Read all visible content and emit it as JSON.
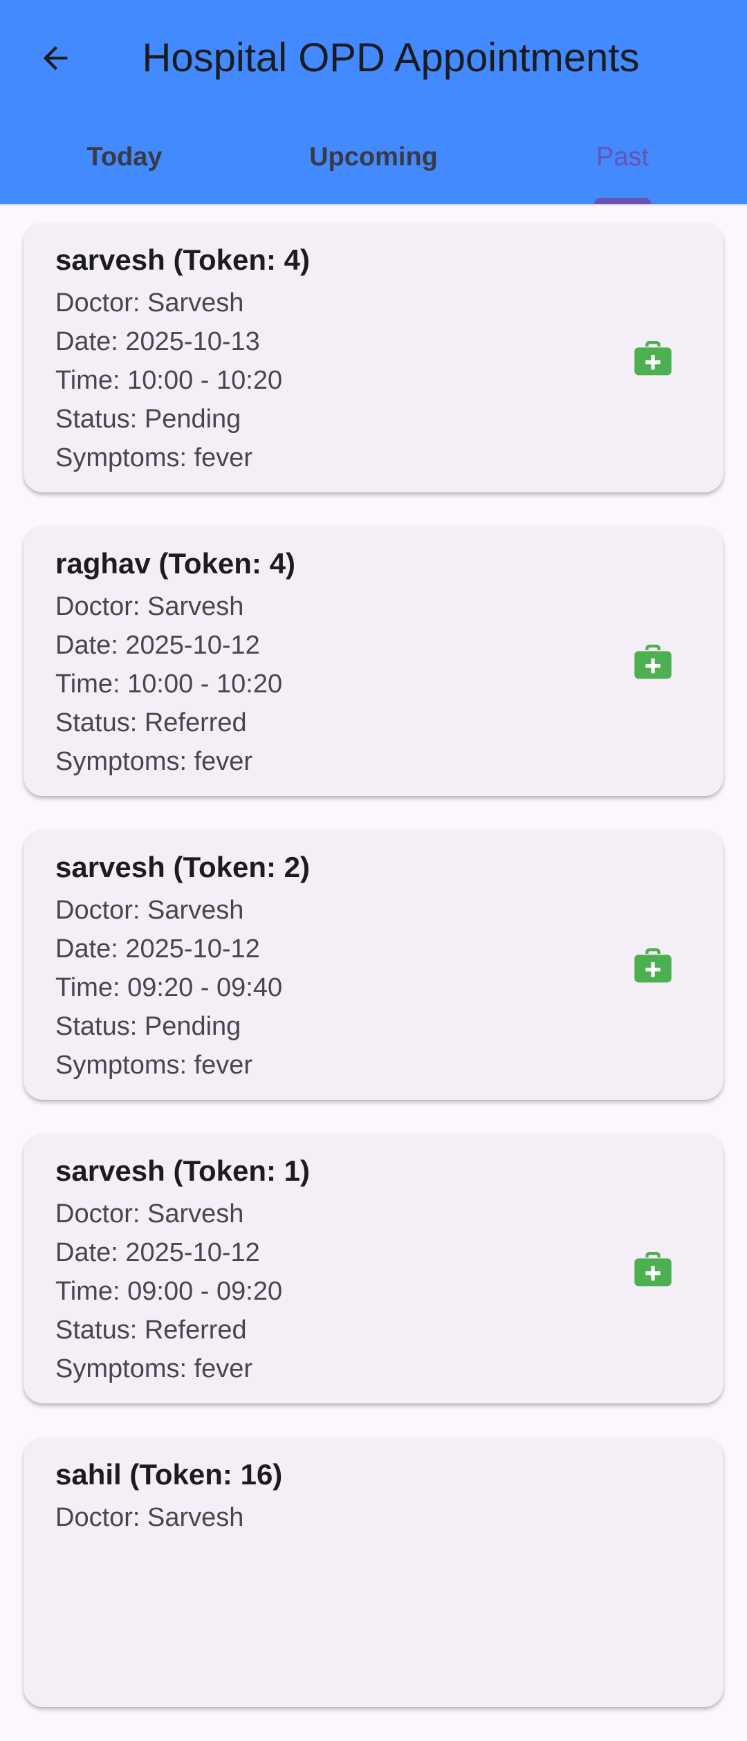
{
  "header": {
    "title": "Hospital OPD Appointments",
    "back_icon": "arrow-back-icon",
    "background_color": "#448AFF"
  },
  "tabs": [
    {
      "label": "Today",
      "active": false
    },
    {
      "label": "Upcoming",
      "active": false
    },
    {
      "label": "Past",
      "active": true
    }
  ],
  "accent_color": "#6A52B2",
  "card_icon": {
    "name": "medical-bag-icon",
    "color": "#4CAF50"
  },
  "appointments": [
    {
      "title": "sarvesh (Token: 4)",
      "doctor": "Doctor: Sarvesh",
      "date": "Date: 2025-10-13",
      "time": "Time: 10:00 - 10:20",
      "status": "Status: Pending",
      "symptoms": "Symptoms: fever"
    },
    {
      "title": "raghav (Token: 4)",
      "doctor": "Doctor: Sarvesh",
      "date": "Date: 2025-10-12",
      "time": "Time: 10:00 - 10:20",
      "status": "Status: Referred",
      "symptoms": "Symptoms: fever"
    },
    {
      "title": "sarvesh (Token: 2)",
      "doctor": "Doctor: Sarvesh",
      "date": "Date: 2025-10-12",
      "time": "Time: 09:20 - 09:40",
      "status": "Status: Pending",
      "symptoms": "Symptoms: fever"
    },
    {
      "title": "sarvesh (Token: 1)",
      "doctor": "Doctor: Sarvesh",
      "date": "Date: 2025-10-12",
      "time": "Time: 09:00 - 09:20",
      "status": "Status: Referred",
      "symptoms": "Symptoms: fever"
    },
    {
      "title": "sahil (Token: 16)",
      "doctor": "Doctor: Sarvesh"
    }
  ]
}
